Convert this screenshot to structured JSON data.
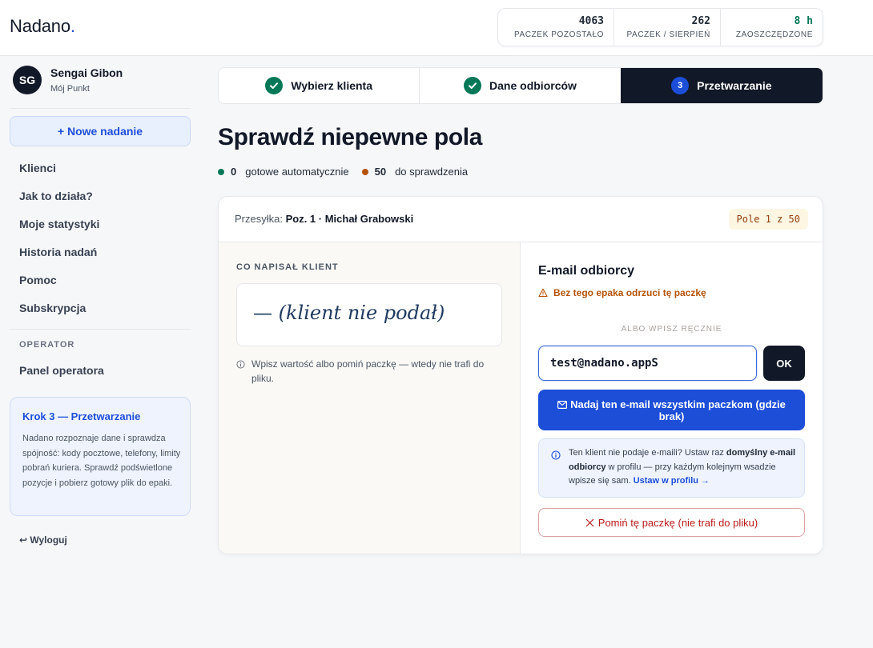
{
  "header": {
    "logo_text": "Nadano",
    "logo_dot": ".",
    "stats": [
      {
        "value": "4063",
        "label": "PACZEK POZOSTAŁO"
      },
      {
        "value": "262",
        "label": "PACZEK / SIERPIEŃ"
      },
      {
        "value": "8 h",
        "label": "ZAOSZCZĘDZONE"
      }
    ]
  },
  "sidebar": {
    "user": {
      "initials": "SG",
      "name": "Sengai Gibon",
      "role": "Mój Punkt"
    },
    "new_button": "+ Nowe nadanie",
    "items": [
      {
        "label": "Klienci"
      },
      {
        "label": "Jak to działa?"
      },
      {
        "label": "Moje statystyki"
      },
      {
        "label": "Historia nadań"
      },
      {
        "label": "Pomoc"
      },
      {
        "label": "Subskrypcja"
      }
    ],
    "operator_section": "OPERATOR",
    "operator_item": "Panel operatora",
    "info": {
      "title": "Krok 3 — Przetwarzanie",
      "text": "Nadano rozpoznaje dane i sprawdza spójność: kody pocztowe, telefony, limity pobrań kuriera. Sprawdź podświetlone pozycje i pobierz gotowy plik do epaki."
    },
    "logout": "↩ Wyloguj"
  },
  "steps": [
    {
      "label": "Wybierz klienta",
      "state": "done"
    },
    {
      "label": "Dane odbiorców",
      "state": "done"
    },
    {
      "number": "3",
      "label": "Przetwarzanie",
      "state": "active"
    }
  ],
  "main": {
    "title": "Sprawdź niepewne pola",
    "counts": {
      "auto_count": "0",
      "auto_label": "gotowe automatycznie",
      "check_count": "50",
      "check_label": "do sprawdzenia"
    },
    "card": {
      "shipment_prefix": "Przesyłka:",
      "shipment_value": "Poz. 1 · Michał Grabowski",
      "field_badge": "Pole 1 z 50",
      "left": {
        "label": "CO NAPISAŁ KLIENT",
        "client_value": "— (klient nie podał)",
        "hint": "Wpisz wartość albo pomiń paczkę — wtedy nie trafi do pliku."
      },
      "right": {
        "field_title": "E-mail odbiorcy",
        "warning": "Bez tego epaka odrzuci tę paczkę",
        "or_label": "ALBO WPISZ RĘCZNIE",
        "input_value": "test@nadano.appS",
        "ok_label": "OK",
        "bulk_label": "Nadaj ten e-mail wszystkim paczkom (gdzie brak)",
        "tip_pre": "Ten klient nie podaje e-maili? Ustaw raz ",
        "tip_bold": "domyślny e-mail odbiorcy",
        "tip_post": " w profilu — przy każdym kolejnym wsadzie wpisze się sam. ",
        "tip_link": "Ustaw w profilu →",
        "skip_label": "Pomiń tę paczkę (nie trafi do pliku)"
      }
    }
  },
  "colors": {
    "accent": "#1d4ed8",
    "dark": "#111827",
    "success": "#047857",
    "warning": "#b45309",
    "danger": "#b91c1c"
  }
}
